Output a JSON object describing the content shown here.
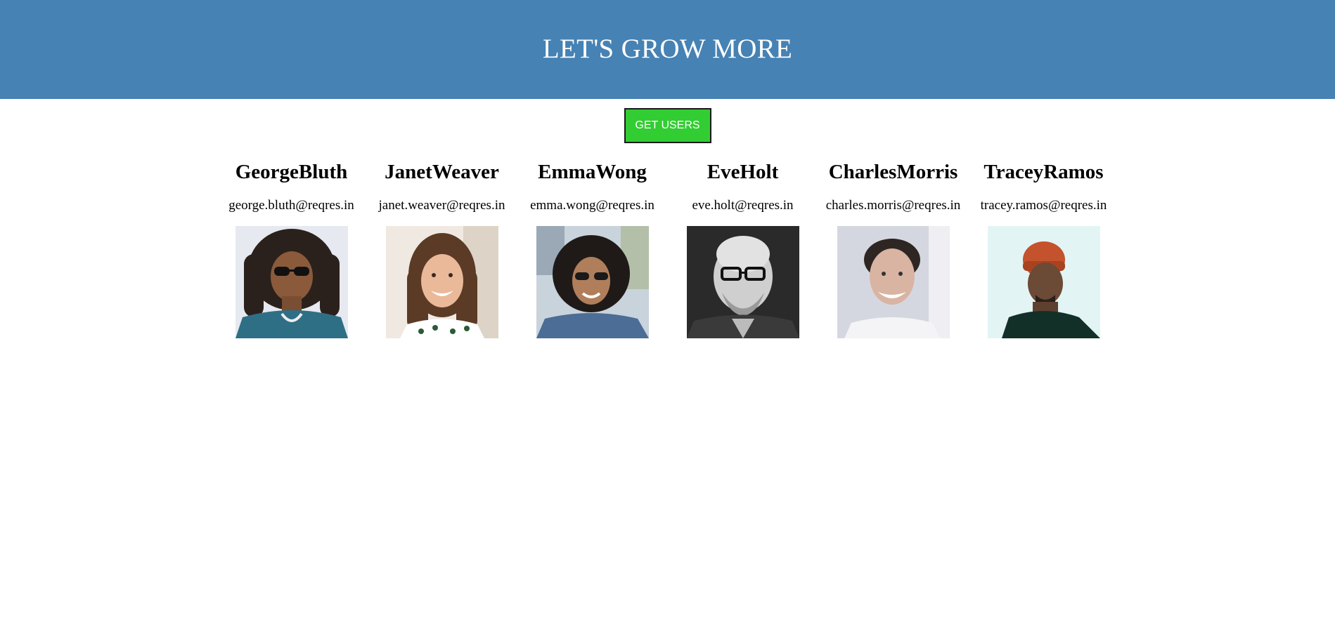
{
  "header": {
    "title": "LET'S GROW MORE",
    "background": "#4682b4"
  },
  "actions": {
    "get_users_label": "GET USERS",
    "button_color": "#32cd32"
  },
  "users": [
    {
      "name": "GeorgeBluth",
      "email": "george.bluth@reqres.in",
      "avatar_icon": "person-photo"
    },
    {
      "name": "JanetWeaver",
      "email": "janet.weaver@reqres.in",
      "avatar_icon": "person-photo"
    },
    {
      "name": "EmmaWong",
      "email": "emma.wong@reqres.in",
      "avatar_icon": "person-photo"
    },
    {
      "name": "EveHolt",
      "email": "eve.holt@reqres.in",
      "avatar_icon": "person-photo"
    },
    {
      "name": "CharlesMorris",
      "email": "charles.morris@reqres.in",
      "avatar_icon": "person-photo"
    },
    {
      "name": "TraceyRamos",
      "email": "tracey.ramos@reqres.in",
      "avatar_icon": "person-photo"
    }
  ]
}
